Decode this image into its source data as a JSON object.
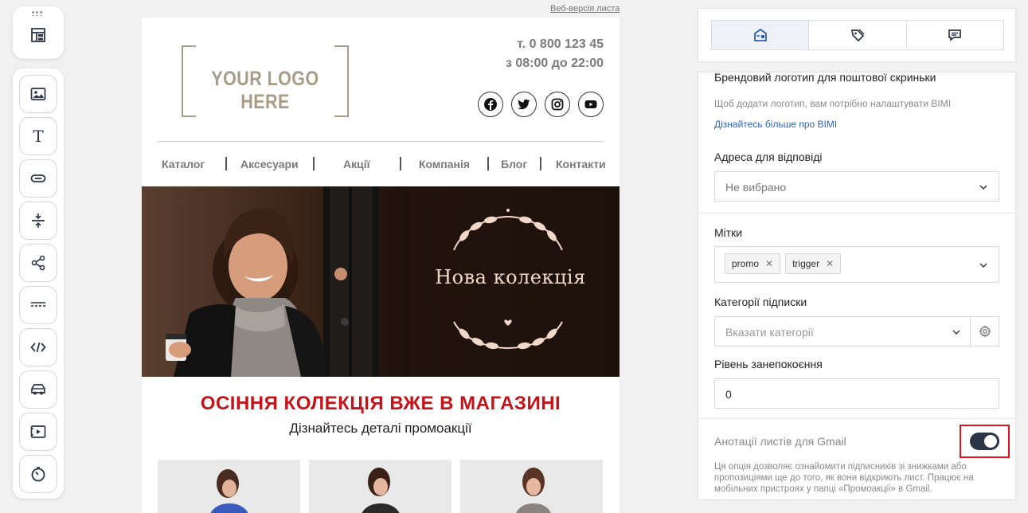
{
  "toolbar": {
    "top_icon": "layout-icon",
    "tools": [
      {
        "name": "image-block-icon"
      },
      {
        "name": "text-block-icon",
        "glyph": "T"
      },
      {
        "name": "button-block-icon"
      },
      {
        "name": "spacer-block-icon"
      },
      {
        "name": "share-block-icon"
      },
      {
        "name": "divider-block-icon"
      },
      {
        "name": "html-block-icon"
      },
      {
        "name": "product-block-icon"
      },
      {
        "name": "video-block-icon"
      },
      {
        "name": "timer-block-icon"
      }
    ]
  },
  "email": {
    "web_version": "Веб-версія листа",
    "logo": "YOUR LOGO HERE",
    "phone": "т. 0 800 123 45",
    "hours": "з 08:00 до 22:00",
    "socials": [
      "facebook-icon",
      "twitter-icon",
      "instagram-icon",
      "youtube-icon"
    ],
    "menu": [
      "Каталог",
      "Аксесуари",
      "Акції",
      "Компанія",
      "Блог",
      "Контакти"
    ],
    "hero_title": "Нова колекція",
    "promo_title": "ОСІННЯ КОЛЕКЦІЯ ВЖЕ В МАГАЗИНІ",
    "promo_sub": "Дізнайтесь деталі промоакції"
  },
  "panel": {
    "tabs": [
      {
        "icon": "email-settings-icon",
        "active": true
      },
      {
        "icon": "tag-icon",
        "active": false
      },
      {
        "icon": "message-icon",
        "active": false
      }
    ],
    "brand_logo_title": "Брендовий логотип для поштової скриньки",
    "brand_logo_hint": "Щоб додати логотип, вам потрібно налаштувати BIMI",
    "brand_logo_link": "Дізнайтесь більше про BIMI",
    "reply_label": "Адреса для відповіді",
    "reply_value": "Не вибрано",
    "tags_label": "Мітки",
    "tags": [
      "promo",
      "trigger"
    ],
    "categories_label": "Категорії підписки",
    "categories_placeholder": "Вказати категорії",
    "concern_label": "Рівень занепокоєння",
    "concern_value": "0",
    "gmail_label": "Анотації листів для Gmail",
    "gmail_enabled": true,
    "gmail_desc": "Ця опція дозволяє ознайомити підписників зі знижками або пропозиціями ще до того, як вони відкриють лист. Працює на мобільних пристроях у папці «Промоакції» в Gmail."
  }
}
